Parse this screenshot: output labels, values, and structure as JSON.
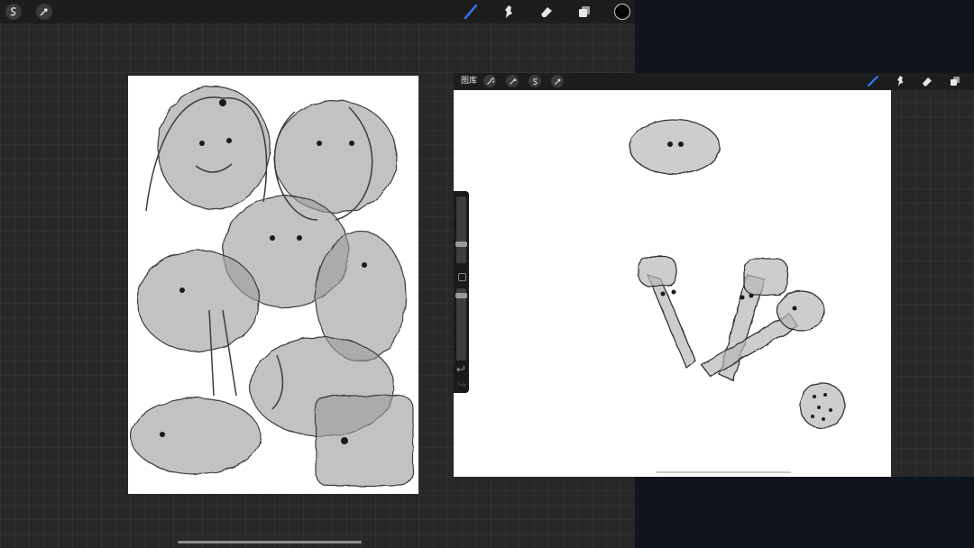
{
  "left_app": {
    "toolbar": {
      "icons": [
        "adjustments-icon",
        "selection-icon",
        "brush-icon",
        "smudge-icon",
        "eraser-icon",
        "layers-icon",
        "color-icon"
      ],
      "accent_color": "#2f7ff5",
      "selected_color": "#050505"
    }
  },
  "right_app": {
    "toolbar": {
      "gallery_label": "图库",
      "icons": [
        "actions-icon",
        "adjustments-icon",
        "selection-icon",
        "transform-icon",
        "brush-icon",
        "smudge-icon",
        "eraser-icon",
        "layers-icon"
      ],
      "accent_color": "#2f7ff5"
    }
  },
  "sidebar": {
    "brush_size_level": 0.35,
    "opacity_level": 0.15,
    "controls": [
      "brush-size-slider",
      "modify-button",
      "opacity-slider",
      "undo-button",
      "redo-button"
    ]
  }
}
